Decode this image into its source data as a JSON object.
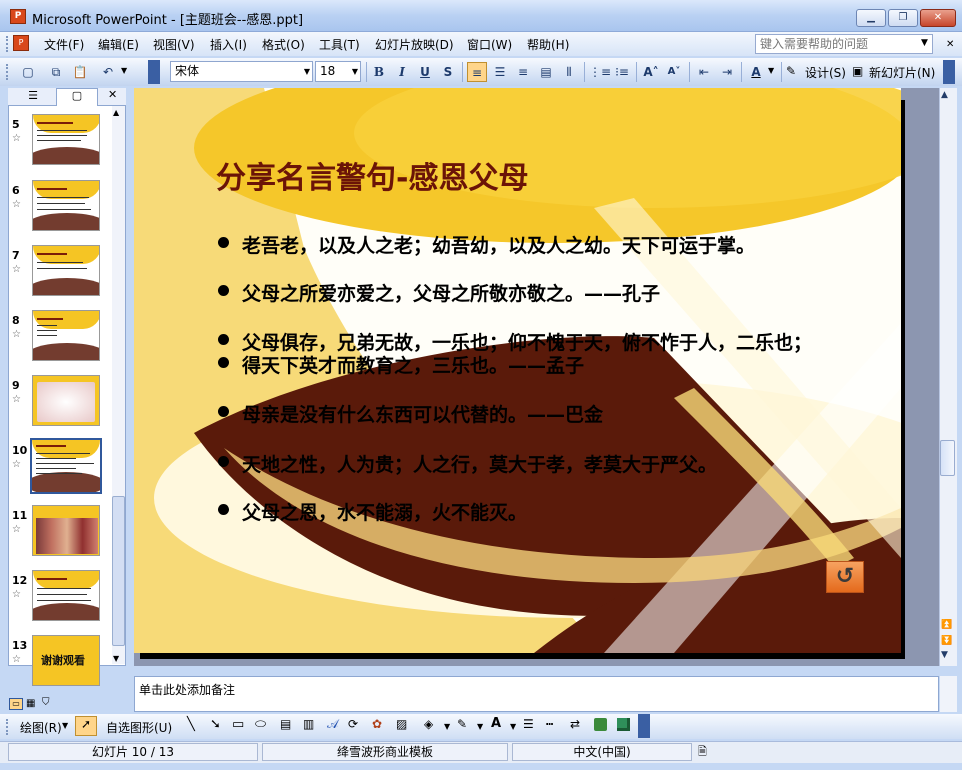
{
  "window": {
    "app_icon": "P",
    "title": "Microsoft PowerPoint - [主题班会--感恩.ppt]",
    "minimize_icon": "minimize-icon",
    "maximize_icon": "maximize-icon",
    "close_icon": "close-icon"
  },
  "menu": {
    "items": [
      "文件(F)",
      "编辑(E)",
      "视图(V)",
      "插入(I)",
      "格式(O)",
      "工具(T)",
      "幻灯片放映(D)",
      "窗口(W)",
      "帮助(H)"
    ],
    "help_placeholder": "键入需要帮助的问题"
  },
  "toolbar": {
    "font_name": "宋体",
    "font_size": "18",
    "bold": "B",
    "italic": "I",
    "underline": "U",
    "shadow": "S",
    "design_label": "设计(S)",
    "new_slide_label": "新幻灯片(N)"
  },
  "slides_panel": {
    "items": [
      {
        "number": "5"
      },
      {
        "number": "6"
      },
      {
        "number": "7"
      },
      {
        "number": "8"
      },
      {
        "number": "9"
      },
      {
        "number": "10"
      },
      {
        "number": "11"
      },
      {
        "number": "12"
      },
      {
        "number": "13"
      }
    ],
    "selected": "10",
    "slide13_text": "谢谢观看"
  },
  "slide": {
    "title": "分享名言警句-感恩父母",
    "bullets": [
      "老吾老，以及人之老；幼吾幼，以及人之幼。天下可运于掌。",
      "父母之所爱亦爱之，父母之所敬亦敬之。——孔子",
      "父母俱存，兄弟无故，一乐也；仰不愧于天，俯不怍于人，二乐也；",
      "得天下英才而教育之，三乐也。——孟子",
      "母亲是没有什么东西可以代替的。——巴金",
      "天地之性，人为贵；人之行，莫大于孝，孝莫大于严父。",
      "父母之恩，水不能溺，火不能灭。"
    ],
    "colors": {
      "title": "#6b1407",
      "gold": "#f5c524",
      "brown": "#5a1a0a"
    }
  },
  "notes": {
    "placeholder": "单击此处添加备注"
  },
  "drawbar": {
    "draw_label": "绘图(R)",
    "autoshape_label": "自选图形(U)"
  },
  "status": {
    "slide_info": "幻灯片 10 / 13",
    "template": "绛雪波形商业模板",
    "language": "中文(中国)"
  }
}
